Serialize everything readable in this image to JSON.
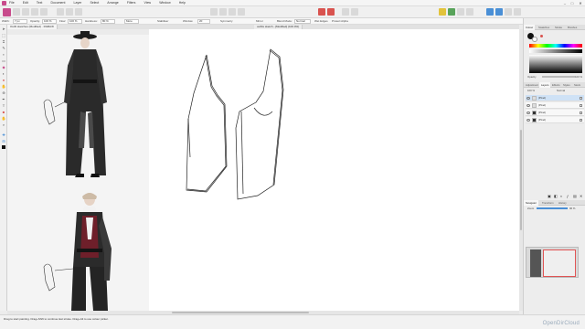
{
  "app": {
    "menu": [
      "File",
      "Edit",
      "Text",
      "Document",
      "Layer",
      "Select",
      "Arrange",
      "Filters",
      "View",
      "Window",
      "Help"
    ],
    "window_controls": {
      "minimize": "–",
      "maximize": "□",
      "close": "✕"
    }
  },
  "context_bar": {
    "width_label": "Width:",
    "width_value": "7 px",
    "opacity_label": "Opacity:",
    "opacity_value": "100 %",
    "flow_label": "Flow:",
    "flow_value": "100 %",
    "hardness_label": "Hardness:",
    "hardness_value": "80 %",
    "more_label": "More",
    "stabiliser_label": "Stabiliser",
    "window_label": "Window",
    "window_value": "20",
    "symmetry_label": "Symmetry",
    "mirror_label": "Mirror",
    "blend_mode_label": "Blend Mode:",
    "blend_mode_value": "Normal",
    "wet_edges_label": "Wet Edges",
    "protect_alpha_label": "Protect Alpha"
  },
  "document": {
    "tabs": [
      "Outfit sketches (Modified) · RGBA/8",
      "outfits sketch - [Modified] (100.0%)"
    ]
  },
  "status": {
    "hint": "Drag to start painting. Drag+Shift to continue last stroke. Drag+Alt to use colour picker.",
    "watermark": "OpenDirCloud"
  },
  "right_panel": {
    "color_tabs": [
      "Colour",
      "Swatches",
      "Stroke",
      "Brushes"
    ],
    "opacity_label": "Opacity",
    "opacity_value": "100 %",
    "layer_tabs": [
      "Adjustment",
      "Layers",
      "Effects",
      "Styles",
      "Stock"
    ],
    "layer_blend": "Normal",
    "layer_opacity": "100 %",
    "layers": [
      {
        "name": "(Pixel)",
        "selected": true
      },
      {
        "name": "(Pixel)",
        "selected": false
      },
      {
        "name": "(Pixel)",
        "selected": false
      },
      {
        "name": "(Pixel)",
        "selected": false
      }
    ],
    "nav_tabs": [
      "Navigator",
      "Transform",
      "History"
    ],
    "zoom_label": "Zoom",
    "zoom_value": "96 %"
  },
  "colors": {
    "accent_pink": "#c84b8c",
    "selection_blue": "#cfe2f6",
    "canvas": "#ffffff"
  },
  "tools": [
    "move-tool",
    "selection-tool",
    "crop-tool",
    "brush-tool",
    "pixel-tool",
    "eraser-tool",
    "fill-tool",
    "gradient-tool",
    "dodge-tool",
    "smudge-tool",
    "clone-tool",
    "pen-tool",
    "text-tool",
    "shape-tool",
    "hand-tool",
    "zoom-tool",
    "color-picker-tool"
  ]
}
